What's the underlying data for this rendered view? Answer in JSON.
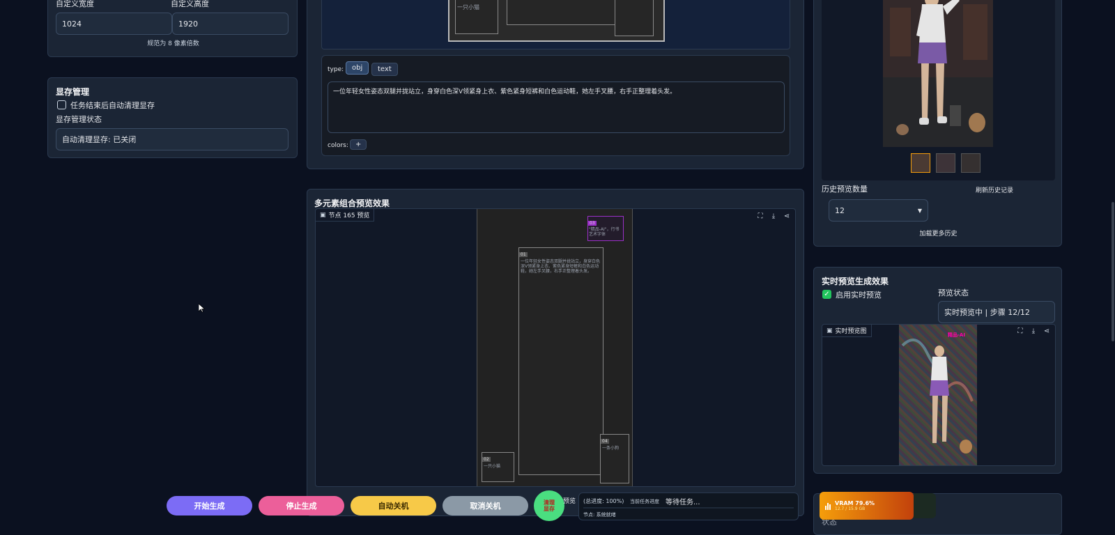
{
  "left": {
    "custom_width_label": "自定义宽度",
    "custom_height_label": "自定义高度",
    "width_value": "1024",
    "height_value": "1920",
    "norm_note": "规范为 8 像素倍数",
    "memory_title": "显存管理",
    "auto_clear_label": "任务结束后自动清理显存",
    "memory_status_label": "显存管理状态",
    "memory_status_value": "自动清理显存: 已关闭"
  },
  "top_center": {
    "canvas_small_label": "一只小猫",
    "type_label": "type:",
    "type_obj": "obj",
    "type_text": "text",
    "prompt_text": "一位年轻女性姿态双腿并拢站立，身穿白色深V领紧身上衣、紫色紧身短裤和白色运动鞋，她左手叉腰，右手正整理着头发。",
    "colors_label": "colors:",
    "colors_add": "+"
  },
  "composite": {
    "title": "多元素组合预览效果",
    "node_label": "节点 165 预览",
    "box03_badge": "03",
    "box03_text": "\"精品-AI\"，行书艺术字体",
    "box01_badge": "01",
    "box01_text": "一位年轻女性姿态双腿并拢站立，身穿白色深V领紧身上衣、紫色紧身短裤和白色运动鞋，她左手叉腰，右手正整理着头发。",
    "box02_badge": "02",
    "box02_text": "一只小猫",
    "box04_badge": "04",
    "box04_text": "一条小狗"
  },
  "history": {
    "count_label": "历史预览数量",
    "refresh_label": "刷新历史记录",
    "count_value": "12",
    "load_more": "加载更多历史"
  },
  "realtime": {
    "title": "实时预览生成效果",
    "enable_label": "启用实时预览",
    "status_label": "预览状态",
    "status_value": "实时预览中 | 步骤 12/12",
    "image_label": "实时预览图",
    "overlay_text": "精品-AI"
  },
  "bottom": {
    "start": "开始生成",
    "stop": "停止生成",
    "auto_shutdown": "自动关机",
    "cancel_shutdown": "取消关机",
    "clear_memory": "清理显存",
    "preview_text": "预览",
    "progress_total": "(总进度: 100%)",
    "progress_current": "当前任务进度",
    "progress_wait": "等待任务...",
    "node_status": "节点: 系统就绪",
    "vram_label": "VRAM 79.6%",
    "vram_detail": "12.7 / 15.9 GB",
    "cut_label": "状态"
  },
  "colors": {
    "start": "#7c6cf5",
    "stop": "#ec5f9a",
    "auto": "#f7c948",
    "cancel": "#8b99a6",
    "clear": "#4ade80",
    "vram": "#f59e0b",
    "accent_purple": "#9b30c8"
  },
  "icons": [
    "image-icon",
    "fullscreen-icon",
    "download-icon",
    "share-icon",
    "chevron-down-icon",
    "cursor-icon",
    "chart-icon"
  ]
}
